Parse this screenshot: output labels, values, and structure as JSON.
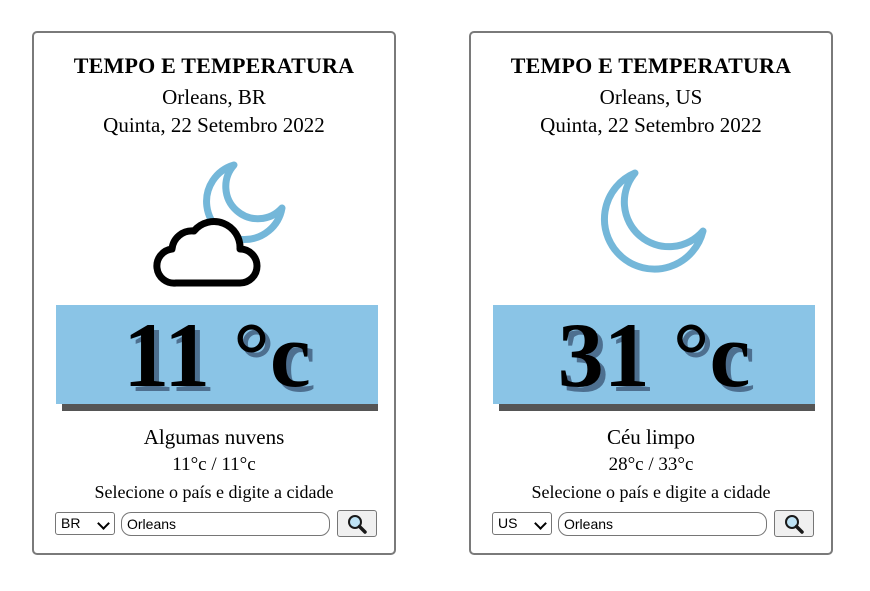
{
  "cards": [
    {
      "title": "TEMPO E TEMPERATURA",
      "location": "Orleans, BR",
      "date": "Quinta, 22 Setembro 2022",
      "icon": "cloud-moon-icon",
      "temperature": "11 °c",
      "description": "Algumas nuvens",
      "min_max": "11°c / 11°c",
      "hint": "Selecione o país e digite a cidade",
      "country_value": "BR",
      "city_value": "Orleans"
    },
    {
      "title": "TEMPO E TEMPERATURA",
      "location": "Orleans, US",
      "date": "Quinta, 22 Setembro 2022",
      "icon": "moon-icon",
      "temperature": "31 °c",
      "description": "Céu limpo",
      "min_max": "28°c / 33°c",
      "hint": "Selecione o país e digite a cidade",
      "country_value": "US",
      "city_value": "Orleans"
    }
  ],
  "colors": {
    "temp_box": "#8ac4e6",
    "moon": "#74b7d9",
    "shadow": "#555555",
    "card_border": "#7a7a7a"
  }
}
